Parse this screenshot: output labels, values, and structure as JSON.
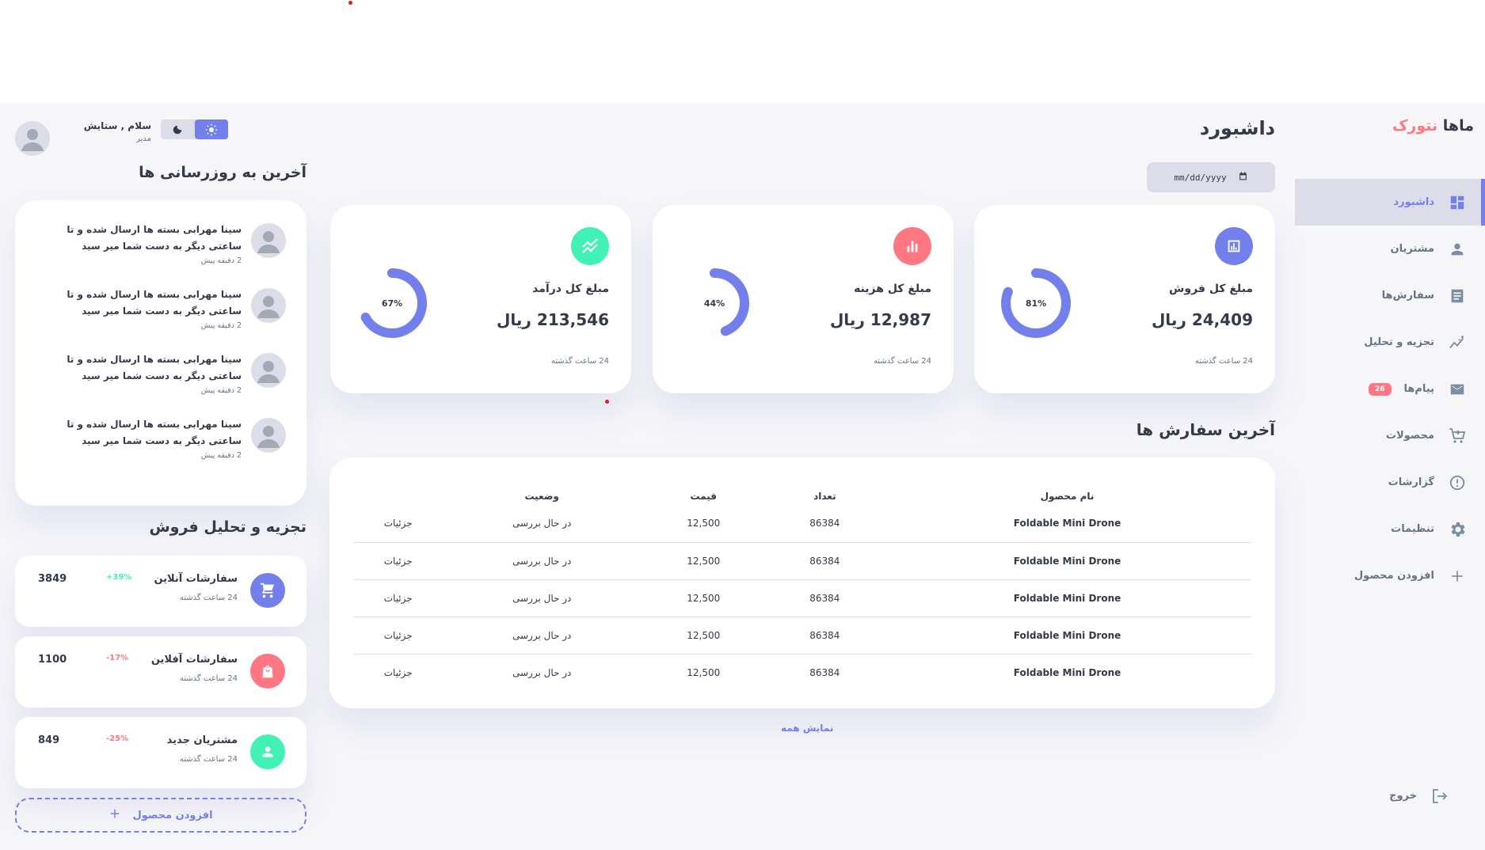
{
  "brand": {
    "part1": "ماها",
    "part2": "نتورک"
  },
  "sidebar": {
    "items": [
      {
        "label": "داشبورد",
        "icon": "grid-icon"
      },
      {
        "label": "مشتریان",
        "icon": "person-icon"
      },
      {
        "label": "سفارش‌ها",
        "icon": "receipt-icon"
      },
      {
        "label": "تجزیه و تحلیل",
        "icon": "insights-icon"
      },
      {
        "label": "پیام‌ها",
        "icon": "mail-icon",
        "badge": "26"
      },
      {
        "label": "محصولات",
        "icon": "cart-icon"
      },
      {
        "label": "گزارشات",
        "icon": "report-icon"
      },
      {
        "label": "تنظیمات",
        "icon": "gear-icon"
      },
      {
        "label": "افزودن محصول",
        "icon": "plus-icon"
      }
    ],
    "logout": "خروج"
  },
  "header": {
    "title": "داشبورد",
    "date_placeholder": "mm/dd/yyyy"
  },
  "cards": [
    {
      "title": "مبلغ کل فروش",
      "value": "24,409 ریال",
      "time": "24 ساعت گذشته",
      "percent": 81,
      "percent_label": "81%",
      "color": "#7380ec",
      "icon": "analytics-icon"
    },
    {
      "title": "مبلغ کل هزینه",
      "value": "12,987 ریال",
      "time": "24 ساعت گذشته",
      "percent": 44,
      "percent_label": "44%",
      "color": "#ff7782",
      "icon": "bar-chart-icon"
    },
    {
      "title": "مبلغ کل درآمد",
      "value": "213,546 ریال",
      "time": "24 ساعت گذشته",
      "percent": 67,
      "percent_label": "67%",
      "color": "#41f1b6",
      "icon": "stocks-icon"
    }
  ],
  "orders": {
    "title": "آخرین سفارش ها",
    "columns": [
      "نام محصول",
      "تعداد",
      "قیمت",
      "وضعیت",
      ""
    ],
    "rows": [
      [
        "Foldable Mini Drone",
        "86384",
        "12,500",
        "در حال بررسی",
        "جزئیات"
      ],
      [
        "Foldable Mini Drone",
        "86384",
        "12,500",
        "در حال بررسی",
        "جزئیات"
      ],
      [
        "Foldable Mini Drone",
        "86384",
        "12,500",
        "در حال بررسی",
        "جزئیات"
      ],
      [
        "Foldable Mini Drone",
        "86384",
        "12,500",
        "در حال بررسی",
        "جزئیات"
      ],
      [
        "Foldable Mini Drone",
        "86384",
        "12,500",
        "در حال بررسی",
        "جزئیات"
      ]
    ],
    "show_all": "نمایش همه"
  },
  "profile": {
    "greeting": "سلام , ستایش",
    "role": "مدیر"
  },
  "updates": {
    "title": "آخرین به روزرسانی ها",
    "items": [
      {
        "text": "سینا مهرابی بسته ها ارسال شده و تا ساعتی دیگر به دست شما میر سید",
        "time": "2 دقیقه پیش"
      },
      {
        "text": "سینا مهرابی بسته ها ارسال شده و تا ساعتی دیگر به دست شما میر سید",
        "time": "2 دقیقه پیش"
      },
      {
        "text": "سینا مهرابی بسته ها ارسال شده و تا ساعتی دیگر به دست شما میر سید",
        "time": "2 دقیقه پیش"
      },
      {
        "text": "سینا مهرابی بسته ها ارسال شده و تا ساعتی دیگر به دست شما میر سید",
        "time": "2 دقیقه پیش"
      }
    ]
  },
  "analytics": {
    "title": "تجزیه و تحلیل فروش",
    "items": [
      {
        "title": "سفارشات آنلاین",
        "time": "24 ساعت گذشته",
        "pct": "+39%",
        "value": "3849",
        "color": "#7380ec",
        "pct_color": "#41f1b6",
        "icon": "cart-icon"
      },
      {
        "title": "سفارشات آفلاین",
        "time": "24 ساعت گذشته",
        "pct": "-17%",
        "value": "1100",
        "color": "#ff7782",
        "pct_color": "#ff7782",
        "icon": "shopping-bag-icon"
      },
      {
        "title": "مشتریان جدید",
        "time": "24 ساعت گذشته",
        "pct": "-25%",
        "value": "849",
        "color": "#41f1b6",
        "pct_color": "#ff7782",
        "icon": "person-icon"
      }
    ],
    "add_product": "افزودن محصول"
  }
}
